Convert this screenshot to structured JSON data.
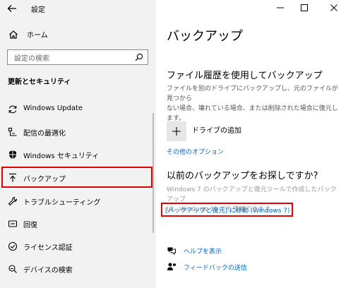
{
  "window": {
    "title": "設定"
  },
  "sidebar": {
    "home_label": "ホーム",
    "search_placeholder": "設定の検索",
    "section_title": "更新とセキュリティ",
    "items": [
      {
        "label": "Windows Update"
      },
      {
        "label": "配信の最適化"
      },
      {
        "label": "Windows セキュリティ"
      },
      {
        "label": "バックアップ"
      },
      {
        "label": "トラブルシューティング"
      },
      {
        "label": "回復"
      },
      {
        "label": "ライセンス認証"
      },
      {
        "label": "デバイスの検索"
      }
    ]
  },
  "main": {
    "title": "バックアップ",
    "file_history": {
      "heading": "ファイル履歴を使用してバックアップ",
      "desc_line1": "ファイルを別のドライブにバックアップし、元のファイルが見つから",
      "desc_line2": "ない場合、壊れている場合、または削除された場合に復元し",
      "desc_line3": "ます。",
      "add_drive_label": "ドライブの追加",
      "other_options": "その他のオプション"
    },
    "older_backup": {
      "heading": "以前のバックアップをお探しですか?",
      "desc_line1": "Windows 7 のバックアップと復元ツールで作成したバックアップ",
      "desc_line2": "は、Windows 10 でも使用できます。",
      "goto_link": "[バックアップと復元] に移動 (Windows 7)"
    },
    "help_label": "ヘルプを表示",
    "feedback_label": "フィードバックの送信"
  }
}
